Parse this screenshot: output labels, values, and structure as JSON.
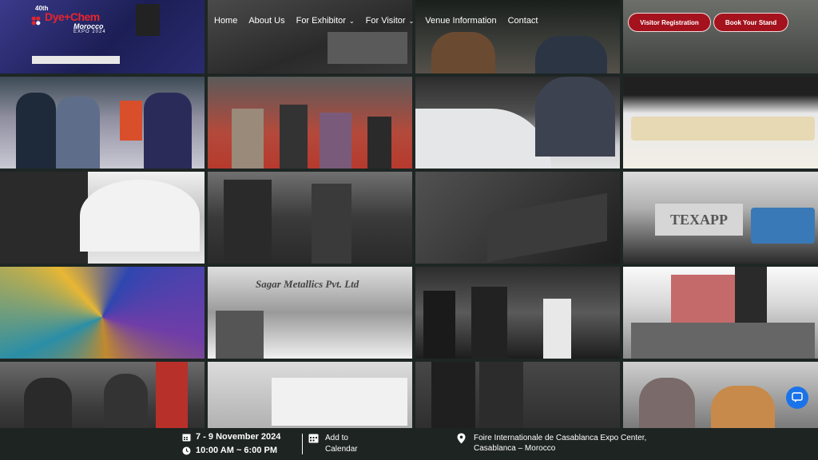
{
  "header": {
    "logo": {
      "year": "40th",
      "name": "Dye+Chem",
      "subtitle": "Morocco",
      "expo_label": "EXPO 2024"
    },
    "nav": [
      {
        "label": "Home",
        "has_dropdown": false
      },
      {
        "label": "About Us",
        "has_dropdown": false
      },
      {
        "label": "For Exhibitor",
        "has_dropdown": true
      },
      {
        "label": "For Visitor",
        "has_dropdown": true
      },
      {
        "label": "Venue Information",
        "has_dropdown": false
      },
      {
        "label": "Contact",
        "has_dropdown": false
      }
    ],
    "buttons": {
      "visitor_registration": "Visitor Registration",
      "book_stand": "Book Your Stand"
    }
  },
  "photos": {
    "sign_texapp": "TEXAPP",
    "sign_sagar": "Sagar Metallics Pvt. Ltd"
  },
  "footer": {
    "date": "7 - 9 November 2024",
    "time": "10:00 AM ~ 6:00 PM",
    "calendar_line1": "Add to",
    "calendar_line2": "Calendar",
    "location": "Foire Internationale de Casablanca Expo Center, Casablanca – Morocco"
  },
  "colors": {
    "accent": "#a4121d",
    "brand_red": "#e9242c",
    "footer_bg": "#1d2422",
    "chat": "#1a73e8"
  },
  "icons": {
    "calendar": "calendar-icon",
    "clock": "clock-icon",
    "location": "location-pin-icon",
    "chat": "chat-icon",
    "caret": "chevron-down-icon"
  }
}
